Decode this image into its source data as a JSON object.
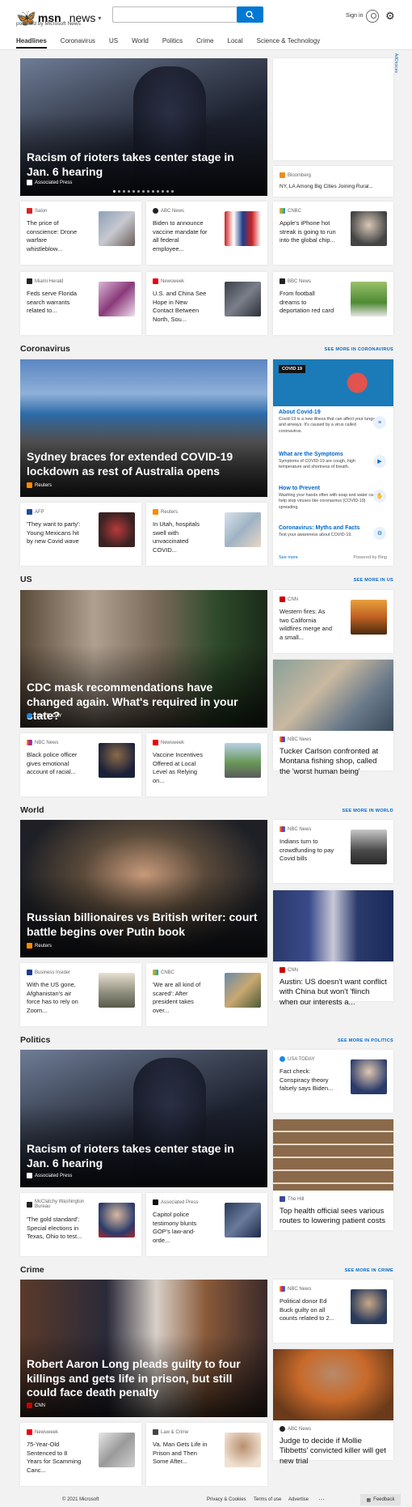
{
  "header": {
    "brand": "msn",
    "product": "news",
    "powered": "powered by Microsoft News",
    "search_placeholder": "",
    "signin": "Sign in"
  },
  "nav": [
    "Headlines",
    "Coronavirus",
    "US",
    "World",
    "Politics",
    "Crime",
    "Local",
    "Science & Technology"
  ],
  "ad_label": "AdChoices",
  "headlines": {
    "hero": {
      "title": "Racism of rioters takes center stage in Jan. 6 hearing",
      "source": "Associated Press"
    },
    "side": {
      "source": "Bloomberg",
      "title": "NY, LA Among Big Cities Joining Rural..."
    },
    "cards": [
      {
        "source": "Salon",
        "title": "The price of conscience: Drone warfare whistleblow..."
      },
      {
        "source": "ABC News",
        "title": "Biden to announce vaccine mandate for all federal employee..."
      },
      {
        "source": "CNBC",
        "title": "Apple's iPhone hot streak is going to run into the global chip..."
      },
      {
        "source": "Miami Herald",
        "title": "Feds serve Florida search warrants related to..."
      },
      {
        "source": "Newsweek",
        "title": "U.S. and China See Hope in New Contact Between North, Sou..."
      },
      {
        "source": "BBC News",
        "title": "From football dreams to deportation red card"
      }
    ]
  },
  "coronavirus": {
    "heading": "Coronavirus",
    "see_more": "SEE MORE IN CORONAVIRUS",
    "hero": {
      "title": "Sydney braces for extended COVID-19 lockdown as rest of Australia opens",
      "source": "Reuters"
    },
    "cards": [
      {
        "source": "AFP",
        "title": "'They want to party': Young Mexicans hit by new Covid wave"
      },
      {
        "source": "Reuters",
        "title": "In Utah, hospitals swell with unvaccinated COVID..."
      }
    ],
    "info": {
      "badge": "COVID 19",
      "items": [
        {
          "h": "About Covid-19",
          "d": "Covid-19 is a new illness that can affect your lungs and airways. It's caused by a virus called coronavirus."
        },
        {
          "h": "What are the Symptoms",
          "d": "Symptoms of COVID-19 are cough, high temperature and shortness of breath."
        },
        {
          "h": "How to Prevent",
          "d": "Washing your hands often with soap and water can help stop viruses like coronavirus (COVID-19) spreading."
        },
        {
          "h": "Coronavirus: Myths and Facts",
          "d": "Test your awareness about COVID-19."
        }
      ],
      "see_more": "See more",
      "powered": "Powered by Bing"
    }
  },
  "us": {
    "heading": "US",
    "see_more": "SEE MORE IN US",
    "hero": {
      "title": "CDC mask recommendations have changed again. What's required in your state?",
      "source": "USA TODAY"
    },
    "side_small": {
      "source": "CNN",
      "title": "Western fires: As two California wildfires merge and a small..."
    },
    "side_big": {
      "source": "NBC News",
      "title": "Tucker Carlson confronted at Montana fishing shop, called the 'worst human being'"
    },
    "cards": [
      {
        "source": "NBC News",
        "title": "Black police officer gives emotional account of racial..."
      },
      {
        "source": "Newsweek",
        "title": "Vaccine Incentives Offered at Local Level as Relying on..."
      }
    ]
  },
  "world": {
    "heading": "World",
    "see_more": "SEE MORE IN WORLD",
    "hero": {
      "title": "Russian billionaires vs British writer: court battle begins over Putin book",
      "source": "Reuters"
    },
    "side_small": {
      "source": "NBC News",
      "title": "Indians turn to crowdfunding to pay Covid bills"
    },
    "side_big": {
      "source": "CNN",
      "title": "Austin: US doesn't want conflict with China but won't 'flinch when our interests a..."
    },
    "cards": [
      {
        "source": "Business Insider",
        "title": "With the US gone, Afghanistan's air force has to rely on Zoom..."
      },
      {
        "source": "CNBC",
        "title": "'We are all kind of scared': After president takes over..."
      }
    ]
  },
  "politics": {
    "heading": "Politics",
    "see_more": "SEE MORE IN POLITICS",
    "hero": {
      "title": "Racism of rioters takes center stage in Jan. 6 hearing",
      "source": "Associated Press"
    },
    "side_small": {
      "source": "USA TODAY",
      "title": "Fact check: Conspiracy theory falsely says Biden..."
    },
    "side_big": {
      "source": "The Hill",
      "title": "Top health official sees various routes to lowering patient costs"
    },
    "cards": [
      {
        "source": "McClatchy Washington Bureau",
        "title": "'The gold standard': Special elections in Texas, Ohio to test..."
      },
      {
        "source": "Associated Press",
        "title": "Capitol police testimony blunts GOP's law-and-orde..."
      }
    ]
  },
  "crime": {
    "heading": "Crime",
    "see_more": "SEE MORE IN CRIME",
    "hero": {
      "title": "Robert Aaron Long pleads guilty to four killings and gets life in prison, but still could face death penalty",
      "source": "CNN"
    },
    "side_small": {
      "source": "NBC News",
      "title": "Political donor Ed Buck guilty on all counts related to 2..."
    },
    "side_big": {
      "source": "ABC News",
      "title": "Judge to decide if Mollie Tibbetts' convicted killer will get new trial"
    },
    "cards": [
      {
        "source": "Newsweek",
        "title": "75-Year-Old Sentenced to 8 Years for Scamming Canc..."
      },
      {
        "source": "Law & Crime",
        "title": "Va. Man Gets Life in Prison and Then Some After..."
      }
    ]
  },
  "footer": {
    "copyright": "© 2021 Microsoft",
    "privacy": "Privacy & Cookies",
    "terms": "Terms of use",
    "advertise": "Advertise",
    "more": "···",
    "feedback": "Feedback"
  }
}
